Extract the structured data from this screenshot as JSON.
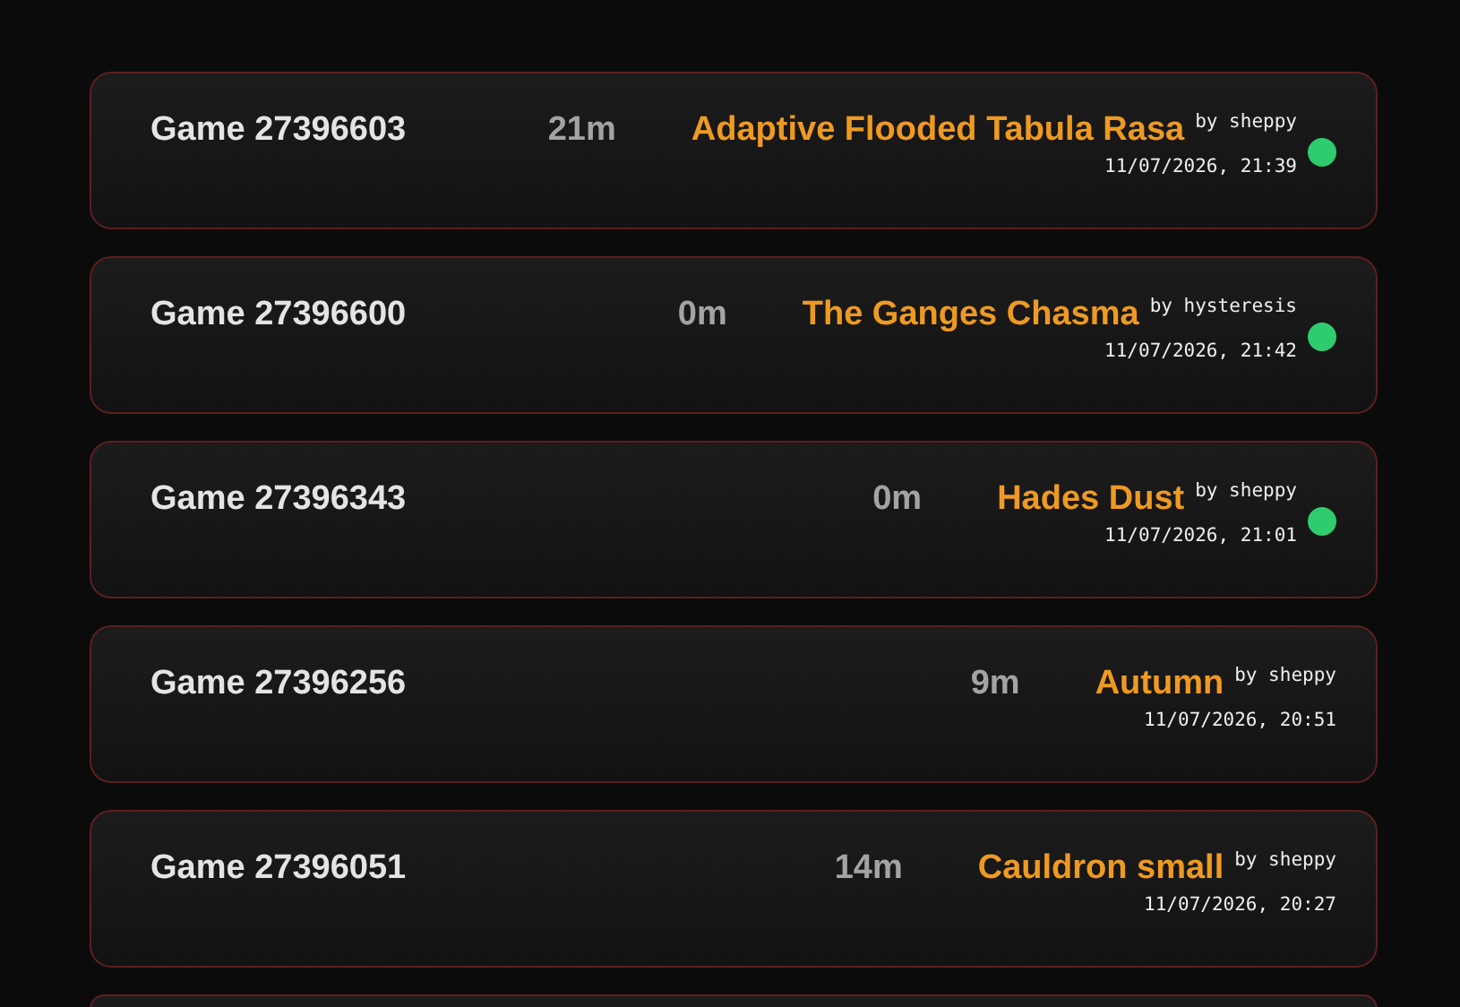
{
  "games": [
    {
      "title": "Game 27396603",
      "duration": "21m",
      "map": "Adaptive Flooded Tabula Rasa",
      "author": "by sheppy",
      "time": "11/07/2026, 21:39",
      "live": true
    },
    {
      "title": "Game 27396600",
      "duration": "0m",
      "map": "The Ganges Chasma",
      "author": "by hysteresis",
      "time": "11/07/2026, 21:42",
      "live": true
    },
    {
      "title": "Game 27396343",
      "duration": "0m",
      "map": "Hades Dust",
      "author": "by sheppy",
      "time": "11/07/2026, 21:01",
      "live": true
    },
    {
      "title": "Game 27396256",
      "duration": "9m",
      "map": "Autumn",
      "author": "by sheppy",
      "time": "11/07/2026, 20:51",
      "live": false
    },
    {
      "title": "Game 27396051",
      "duration": "14m",
      "map": "Cauldron small",
      "author": "by sheppy",
      "time": "11/07/2026, 20:27",
      "live": false
    }
  ],
  "more_below": true
}
